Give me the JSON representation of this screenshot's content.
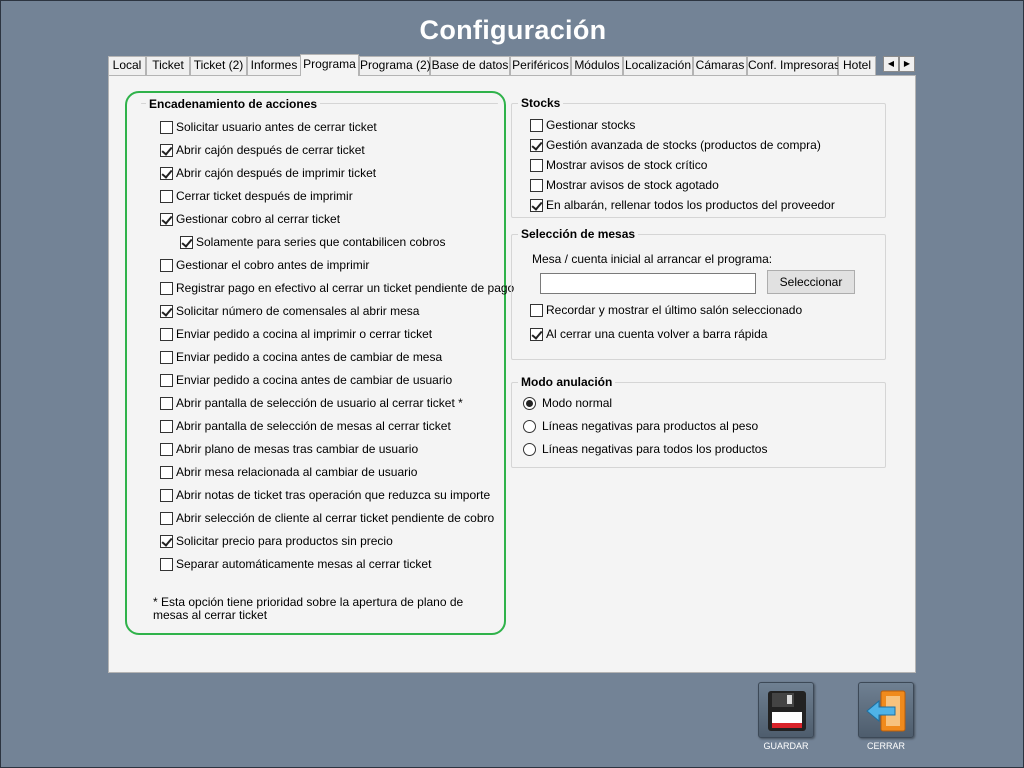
{
  "window": {
    "title": "Configuración"
  },
  "tabs": [
    {
      "label": "Local",
      "active": false
    },
    {
      "label": "Ticket",
      "active": false
    },
    {
      "label": "Ticket (2)",
      "active": false
    },
    {
      "label": "Informes",
      "active": false
    },
    {
      "label": "Programa",
      "active": true
    },
    {
      "label": "Programa (2)",
      "active": false
    },
    {
      "label": "Base de datos",
      "active": false
    },
    {
      "label": "Periféricos",
      "active": false
    },
    {
      "label": "Módulos",
      "active": false
    },
    {
      "label": "Localización",
      "active": false
    },
    {
      "label": "Cámaras",
      "active": false
    },
    {
      "label": "Conf. Impresoras",
      "active": false
    },
    {
      "label": "Hotel",
      "active": false
    }
  ],
  "tab_scroll": {
    "left_icon": "arrow-left-icon",
    "right_icon": "arrow-right-icon"
  },
  "encadenamiento": {
    "title": "Encadenamiento de acciones",
    "items": [
      {
        "label": "Solicitar usuario antes de cerrar ticket",
        "checked": false
      },
      {
        "label": "Abrir cajón después de cerrar ticket",
        "checked": true
      },
      {
        "label": "Abrir cajón después de imprimir ticket",
        "checked": true
      },
      {
        "label": "Cerrar ticket después de imprimir",
        "checked": false
      },
      {
        "label": "Gestionar cobro al cerrar ticket",
        "checked": true
      },
      {
        "label": "Solamente para series que contabilicen cobros",
        "checked": true
      },
      {
        "label": "Gestionar el cobro antes de imprimir",
        "checked": false
      },
      {
        "label": "Registrar pago en efectivo al cerrar un ticket pendiente de pago",
        "checked": false
      },
      {
        "label": "Solicitar número de comensales al abrir mesa",
        "checked": true
      },
      {
        "label": "Enviar pedido a cocina al imprimir o cerrar ticket",
        "checked": false
      },
      {
        "label": "Enviar pedido a cocina antes de cambiar de mesa",
        "checked": false
      },
      {
        "label": "Enviar pedido a cocina antes de cambiar de usuario",
        "checked": false
      },
      {
        "label": "Abrir pantalla de selección de usuario al cerrar ticket *",
        "checked": false
      },
      {
        "label": "Abrir pantalla de selección de mesas al cerrar ticket",
        "checked": false
      },
      {
        "label": "Abrir plano de mesas tras cambiar de usuario",
        "checked": false
      },
      {
        "label": "Abrir mesa relacionada al cambiar de usuario",
        "checked": false
      },
      {
        "label": "Abrir notas de ticket tras operación que reduzca su importe",
        "checked": false
      },
      {
        "label": "Abrir selección de cliente al cerrar ticket pendiente de cobro",
        "checked": false
      },
      {
        "label": "Solicitar precio para productos sin precio",
        "checked": true
      },
      {
        "label": "Separar automáticamente mesas al cerrar ticket",
        "checked": false
      }
    ],
    "footnote": "* Esta opción tiene prioridad sobre la apertura de plano de mesas al cerrar ticket"
  },
  "stocks": {
    "title": "Stocks",
    "items": [
      {
        "label": "Gestionar stocks",
        "checked": false
      },
      {
        "label": "Gestión avanzada de stocks (productos de compra)",
        "checked": true
      },
      {
        "label": "Mostrar avisos de stock crítico",
        "checked": false
      },
      {
        "label": "Mostrar avisos de stock agotado",
        "checked": false
      },
      {
        "label": "En albarán, rellenar todos los productos del proveedor",
        "checked": true
      }
    ]
  },
  "mesas": {
    "title": "Selección de mesas",
    "input_label": "Mesa / cuenta inicial al arrancar el programa:",
    "input_value": "",
    "select_button": "Seleccionar",
    "items": [
      {
        "label": "Recordar y mostrar el último salón seleccionado",
        "checked": false
      },
      {
        "label": "Al cerrar una cuenta volver a barra rápida",
        "checked": true
      }
    ]
  },
  "anulacion": {
    "title": "Modo anulación",
    "options": [
      {
        "label": "Modo normal",
        "selected": true
      },
      {
        "label": "Líneas negativas para productos al peso",
        "selected": false
      },
      {
        "label": "Líneas negativas para todos los productos",
        "selected": false
      }
    ]
  },
  "actions": {
    "save": {
      "label": "GUARDAR",
      "icon": "floppy-disk-icon"
    },
    "close": {
      "label": "CERRAR",
      "icon": "exit-door-icon"
    }
  },
  "colors": {
    "background": "#738396",
    "highlight_border": "#2fb24a"
  }
}
